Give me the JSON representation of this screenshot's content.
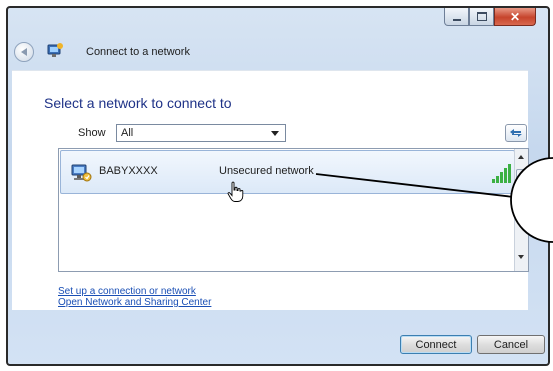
{
  "window": {
    "title": "Connect to a network",
    "caption_buttons": [
      "minimize-icon",
      "maximize-icon",
      "close-icon"
    ]
  },
  "dialog": {
    "heading": "Select a network to connect to",
    "show_label": "Show",
    "show_value": "All"
  },
  "networks": [
    {
      "name": "BABYXXXX",
      "status": "Unsecured network",
      "icon": "network-icon",
      "signal": "signal-strength-icon"
    }
  ],
  "links": {
    "setup": "Set up a connection or network",
    "sharing_center": "Open Network and Sharing Center"
  },
  "buttons": {
    "connect": "Connect",
    "cancel": "Cancel"
  },
  "colors": {
    "heading": "#1e3287",
    "link": "#1a4fb5",
    "signal": "#3cb043"
  }
}
